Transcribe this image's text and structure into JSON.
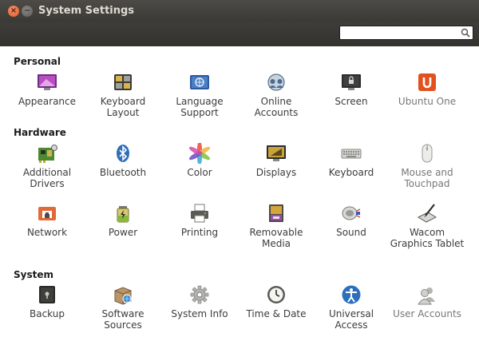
{
  "window": {
    "title": "System Settings",
    "close_glyph": "×",
    "minimize_glyph": "−"
  },
  "search": {
    "value": "",
    "placeholder": ""
  },
  "sections": {
    "personal": "Personal",
    "hardware": "Hardware",
    "system": "System"
  },
  "items": {
    "appearance": "Appearance",
    "keyboard_layout": "Keyboard Layout",
    "language_support": "Language Support",
    "online_accounts": "Online Accounts",
    "screen": "Screen",
    "ubuntu_one": "Ubuntu One",
    "additional_drivers": "Additional Drivers",
    "bluetooth": "Bluetooth",
    "color": "Color",
    "displays": "Displays",
    "keyboard": "Keyboard",
    "mouse_touchpad": "Mouse and Touchpad",
    "network": "Network",
    "power": "Power",
    "printing": "Printing",
    "removable_media": "Removable Media",
    "sound": "Sound",
    "wacom": "Wacom Graphics Tablet",
    "backup": "Backup",
    "software_sources": "Software Sources",
    "system_info": "System Info",
    "time_date": "Time & Date",
    "universal_access": "Universal Access",
    "user_accounts": "User Accounts"
  },
  "colors": {
    "titlebar": "#3c3b37",
    "title_text": "#dfdbd2",
    "close_button": "#e35b2b",
    "ubuntu_one": "#e2511e"
  }
}
